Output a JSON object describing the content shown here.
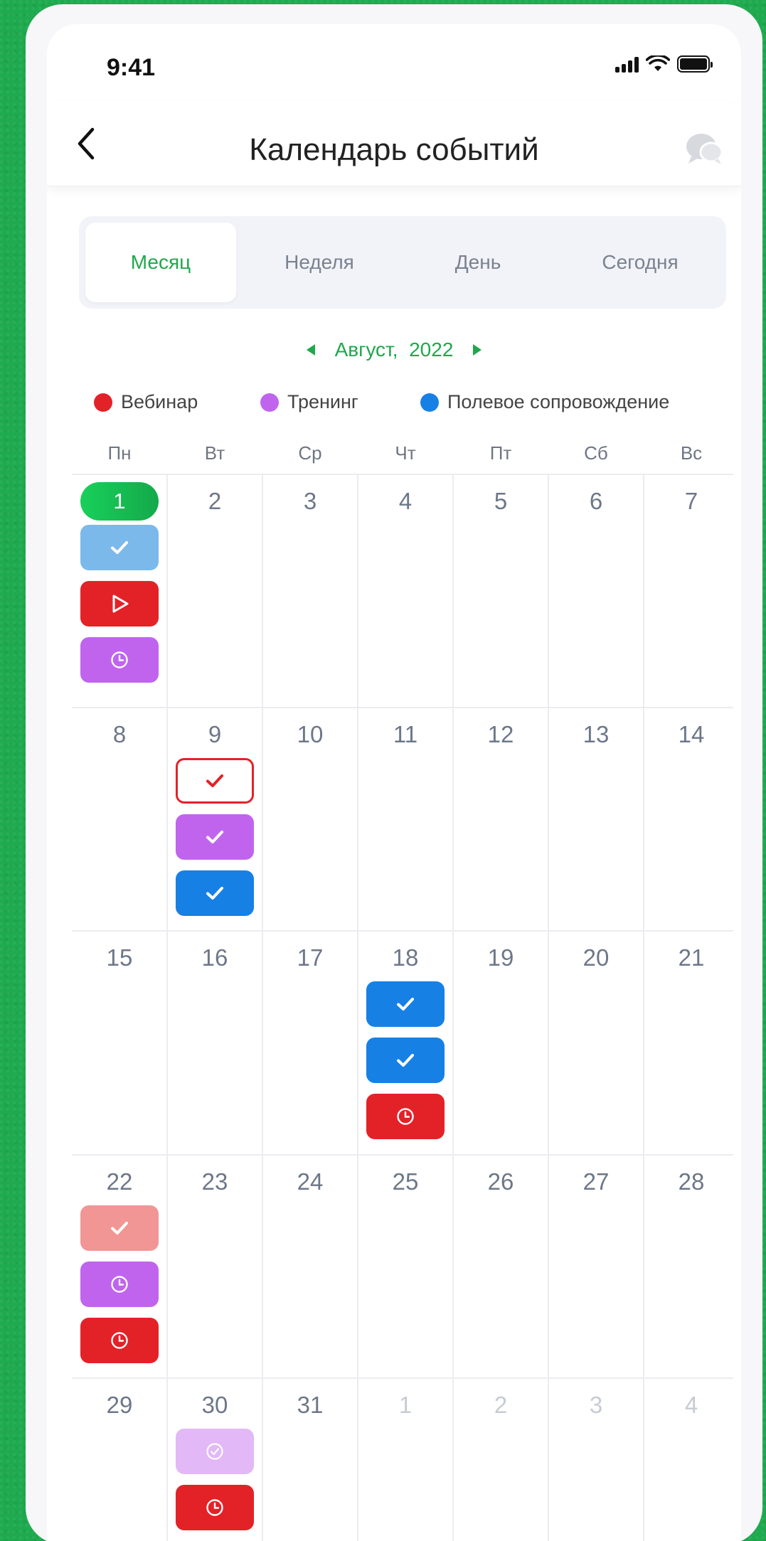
{
  "status_bar": {
    "time": "9:41"
  },
  "header": {
    "title": "Календарь событий"
  },
  "tabs": [
    {
      "label": "Месяц",
      "active": true
    },
    {
      "label": "Неделя",
      "active": false
    },
    {
      "label": "День",
      "active": false
    },
    {
      "label": "Сегодня",
      "active": false
    }
  ],
  "month_nav": {
    "label": "Август,  2022"
  },
  "legend": [
    {
      "label": "Вебинар",
      "color": "#e32228"
    },
    {
      "label": "Тренинг",
      "color": "#c064ee"
    },
    {
      "label": "Полевое сопровождение",
      "color": "#1780e5"
    }
  ],
  "colors": {
    "accent": "#1fa84c",
    "webinar": "#e32228",
    "webinar_light": "#f29595",
    "training": "#c064ee",
    "training_light": "#e2b8f6",
    "field": "#1780e5",
    "field_light": "#7cb9eb"
  },
  "weekdays": [
    "Пн",
    "Вт",
    "Ср",
    "Чт",
    "Пт",
    "Сб",
    "Вс"
  ],
  "weeks": [
    [
      {
        "day": "1",
        "today": true,
        "events": [
          {
            "type": "field_light",
            "icon": "check-icon"
          },
          {
            "type": "webinar",
            "icon": "play-icon"
          },
          {
            "type": "training",
            "icon": "clock-icon"
          }
        ]
      },
      {
        "day": "2",
        "events": []
      },
      {
        "day": "3",
        "events": []
      },
      {
        "day": "4",
        "events": []
      },
      {
        "day": "5",
        "events": []
      },
      {
        "day": "6",
        "events": []
      },
      {
        "day": "7",
        "events": []
      }
    ],
    [
      {
        "day": "8",
        "events": []
      },
      {
        "day": "9",
        "events": [
          {
            "type": "webinar_outline",
            "icon": "check-icon"
          },
          {
            "type": "training",
            "icon": "check-icon"
          },
          {
            "type": "field",
            "icon": "check-icon"
          }
        ]
      },
      {
        "day": "10",
        "events": []
      },
      {
        "day": "11",
        "events": []
      },
      {
        "day": "12",
        "events": []
      },
      {
        "day": "13",
        "events": []
      },
      {
        "day": "14",
        "events": []
      }
    ],
    [
      {
        "day": "15",
        "events": []
      },
      {
        "day": "16",
        "events": []
      },
      {
        "day": "17",
        "events": []
      },
      {
        "day": "18",
        "events": [
          {
            "type": "field",
            "icon": "check-icon"
          },
          {
            "type": "field",
            "icon": "check-icon"
          },
          {
            "type": "webinar",
            "icon": "clock-icon"
          }
        ]
      },
      {
        "day": "19",
        "events": []
      },
      {
        "day": "20",
        "events": []
      },
      {
        "day": "21",
        "events": []
      }
    ],
    [
      {
        "day": "22",
        "events": [
          {
            "type": "webinar_light",
            "icon": "check-icon"
          },
          {
            "type": "training",
            "icon": "clock-icon"
          },
          {
            "type": "webinar",
            "icon": "clock-icon"
          }
        ]
      },
      {
        "day": "23",
        "events": []
      },
      {
        "day": "24",
        "events": []
      },
      {
        "day": "25",
        "events": []
      },
      {
        "day": "26",
        "events": []
      },
      {
        "day": "27",
        "events": []
      },
      {
        "day": "28",
        "events": []
      }
    ],
    [
      {
        "day": "29",
        "events": []
      },
      {
        "day": "30",
        "events": [
          {
            "type": "training_light",
            "icon": "check-circle-icon"
          },
          {
            "type": "webinar",
            "icon": "clock-icon"
          }
        ]
      },
      {
        "day": "31",
        "events": []
      },
      {
        "day": "1",
        "muted": true,
        "events": []
      },
      {
        "day": "2",
        "muted": true,
        "events": []
      },
      {
        "day": "3",
        "muted": true,
        "events": []
      },
      {
        "day": "4",
        "muted": true,
        "events": []
      }
    ]
  ]
}
